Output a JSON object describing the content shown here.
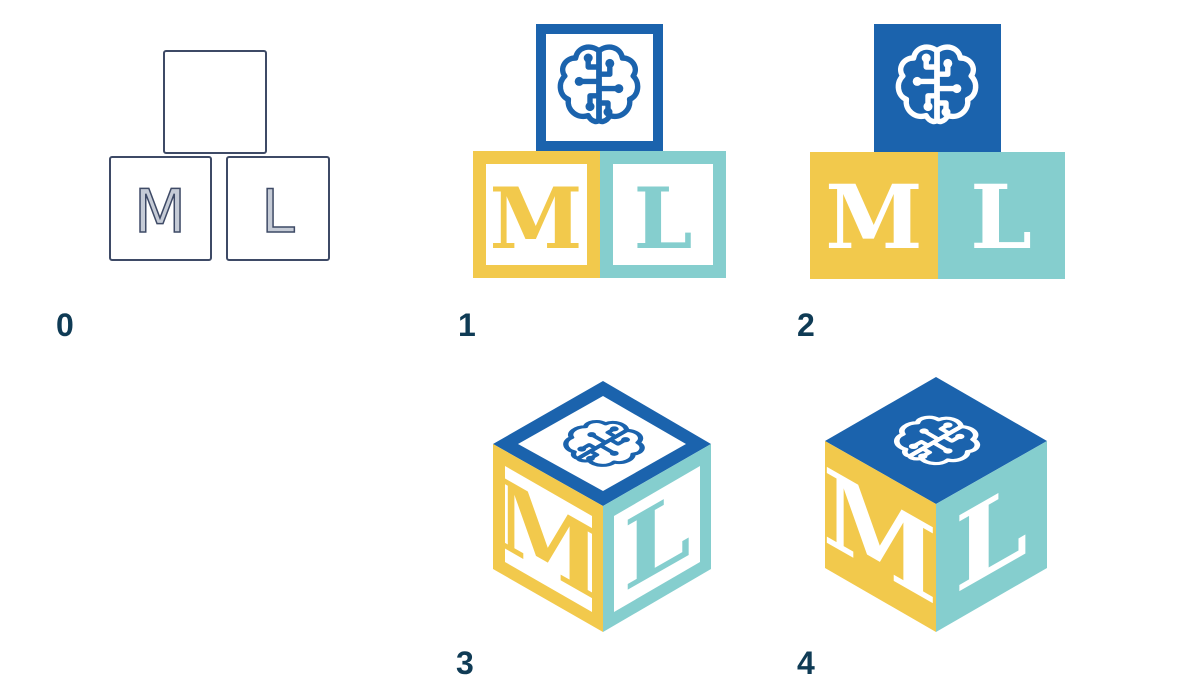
{
  "colors": {
    "blue": "#1b63ad",
    "yellow": "#f2c94c",
    "teal": "#85cece",
    "navy_label": "#0f3b55",
    "sketch_stroke": "#3e4a66",
    "sketch_letter_fill": "#c5cbd6",
    "white": "#ffffff"
  },
  "icons": {
    "top_block": "brain-circuit-icon"
  },
  "steps": [
    {
      "label": "0",
      "letters": [
        "M",
        "L"
      ],
      "style": "wireframe sketch"
    },
    {
      "label": "1",
      "letters": [
        "M",
        "L"
      ],
      "style": "outlined color blocks"
    },
    {
      "label": "2",
      "letters": [
        "M",
        "L"
      ],
      "style": "solid color blocks"
    },
    {
      "label": "3",
      "letters": [
        "M",
        "L"
      ],
      "style": "isometric outlined cube"
    },
    {
      "label": "4",
      "letters": [
        "M",
        "L"
      ],
      "style": "isometric solid cube"
    }
  ]
}
